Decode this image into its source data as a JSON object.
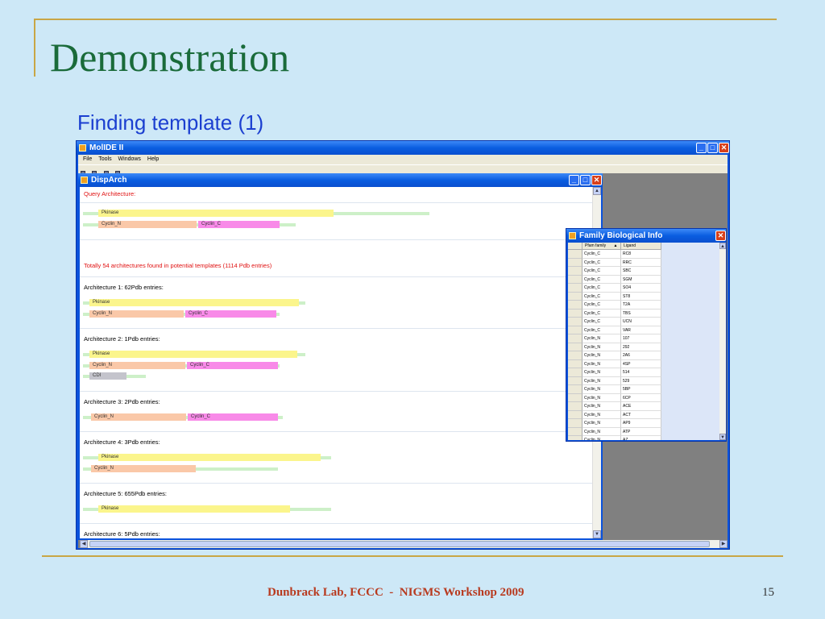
{
  "slide": {
    "title": "Demonstration",
    "subtitle": "Finding template (1)",
    "footer": "Dunbrack Lab, FCCC  -  NIGMS Workshop 2009",
    "page_number": "15"
  },
  "app": {
    "title": "MolIDE II",
    "menu": [
      "File",
      "Tools",
      "Windows",
      "Help"
    ]
  },
  "disparch": {
    "title": "DispArch",
    "query_label": "Query Architecture:",
    "summary": "Totally 54 architectures found in potential templates (1114 Pdb entries)",
    "architectures": [
      {
        "label": "Architecture 1: 62Pdb entries:"
      },
      {
        "label": "Architecture 2: 1Pdb entries:"
      },
      {
        "label": "Architecture 3: 2Pdb entries:"
      },
      {
        "label": "Architecture 4: 3Pdb entries:"
      },
      {
        "label": "Architecture 5: 655Pdb entries:"
      },
      {
        "label": "Architecture 6: 5Pdb entries:"
      }
    ],
    "domains": {
      "pkinase": "Pkinase",
      "cyclin_n": "Cyclin_N",
      "cyclin_c": "Cyclin_C",
      "cdi": "CDI"
    }
  },
  "family_info": {
    "title": "Family Biological Info",
    "columns": [
      "Pfam family",
      "Ligand"
    ],
    "sort_indicator": "▲",
    "rows": [
      [
        "Cyclin_C",
        "RC8"
      ],
      [
        "Cyclin_C",
        "RRC"
      ],
      [
        "Cyclin_C",
        "SBC"
      ],
      [
        "Cyclin_C",
        "SGM"
      ],
      [
        "Cyclin_C",
        "SO4"
      ],
      [
        "Cyclin_C",
        "ST8"
      ],
      [
        "Cyclin_C",
        "T2A"
      ],
      [
        "Cyclin_C",
        "TBS"
      ],
      [
        "Cyclin_C",
        "UCN"
      ],
      [
        "Cyclin_C",
        "VAR"
      ],
      [
        "Cyclin_N",
        "107"
      ],
      [
        "Cyclin_N",
        "292"
      ],
      [
        "Cyclin_N",
        "2A6"
      ],
      [
        "Cyclin_N",
        "4SP"
      ],
      [
        "Cyclin_N",
        "514"
      ],
      [
        "Cyclin_N",
        "529"
      ],
      [
        "Cyclin_N",
        "5BP"
      ],
      [
        "Cyclin_N",
        "6CP"
      ],
      [
        "Cyclin_N",
        "ACE"
      ],
      [
        "Cyclin_N",
        "ACT"
      ],
      [
        "Cyclin_N",
        "AP9"
      ],
      [
        "Cyclin_N",
        "ATP"
      ],
      [
        "Cyclin_N",
        "AZ"
      ]
    ]
  }
}
